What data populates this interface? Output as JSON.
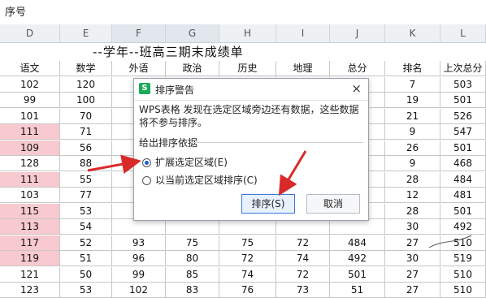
{
  "app": {
    "name_box": "序号"
  },
  "columns": [
    "D",
    "E",
    "F",
    "G",
    "H",
    "I",
    "J",
    "K",
    "L"
  ],
  "sheet": {
    "title": "--学年--班高三期末成绩单",
    "headers": [
      "语文",
      "数学",
      "外语",
      "政治",
      "历史",
      "地理",
      "总分",
      "排名",
      "上次总分"
    ],
    "rows": [
      [
        "102",
        "120",
        "",
        "",
        "",
        "",
        "",
        "7",
        "503"
      ],
      [
        "99",
        "100",
        "",
        "",
        "",
        "",
        "",
        "19",
        "501"
      ],
      [
        "101",
        "70",
        "",
        "",
        "",
        "",
        "",
        "21",
        "526"
      ],
      [
        "111",
        "71",
        "",
        "",
        "",
        "",
        "",
        "9",
        "547"
      ],
      [
        "109",
        "56",
        "",
        "",
        "",
        "",
        "",
        "26",
        "501"
      ],
      [
        "128",
        "88",
        "",
        "",
        "",
        "",
        "",
        "9",
        "468"
      ],
      [
        "111",
        "55",
        "",
        "",
        "",
        "",
        "",
        "28",
        "484"
      ],
      [
        "103",
        "77",
        "",
        "",
        "",
        "",
        "",
        "12",
        "481"
      ],
      [
        "115",
        "53",
        "",
        "",
        "",
        "",
        "",
        "28",
        "501"
      ],
      [
        "113",
        "54",
        "",
        "",
        "",
        "",
        "",
        "30",
        "492"
      ],
      [
        "117",
        "52",
        "93",
        "75",
        "75",
        "72",
        "484",
        "27",
        "510"
      ],
      [
        "119",
        "51",
        "96",
        "80",
        "72",
        "74",
        "492",
        "30",
        "519"
      ],
      [
        "121",
        "50",
        "99",
        "85",
        "74",
        "72",
        "501",
        "27",
        "510"
      ],
      [
        "123",
        "53",
        "102",
        "83",
        "76",
        "73",
        "51",
        "27",
        "510"
      ]
    ],
    "highlighted_rows": [
      3,
      4,
      6,
      8,
      9,
      10,
      11
    ]
  },
  "dialog": {
    "logo": "S",
    "title": "排序警告",
    "close": "×",
    "message": "WPS表格 发现在选定区域旁边还有数据，这些数据将不参与排序。",
    "group_label": "给出排序依据",
    "options": [
      {
        "label": "扩展选定区域(E)",
        "selected": true
      },
      {
        "label": "以当前选定区域排序(C)",
        "selected": false
      }
    ],
    "ok_label": "排序(S)",
    "cancel_label": "取消"
  },
  "annotation_color": "#d92a2a"
}
